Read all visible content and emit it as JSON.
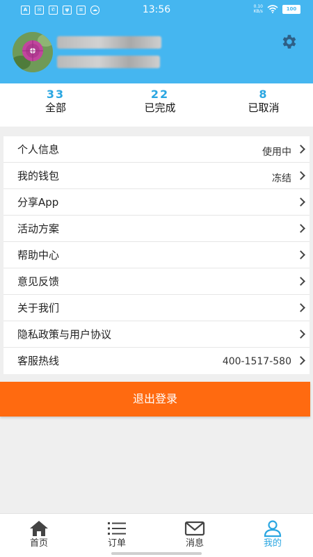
{
  "status_bar": {
    "time": "13:56",
    "network_speed": "0.10\nKB/s",
    "battery": "100"
  },
  "stats": [
    {
      "count": "33",
      "label": "全部"
    },
    {
      "count": "22",
      "label": "已完成"
    },
    {
      "count": "8",
      "label": "已取消"
    }
  ],
  "menu": [
    {
      "label": "个人信息",
      "value": "使用中"
    },
    {
      "label": "我的钱包",
      "value": "冻结"
    },
    {
      "label": "分享App",
      "value": ""
    },
    {
      "label": "活动方案",
      "value": ""
    },
    {
      "label": "帮助中心",
      "value": ""
    },
    {
      "label": "意见反馈",
      "value": ""
    },
    {
      "label": "关于我们",
      "value": ""
    },
    {
      "label": "隐私政策与用户协议",
      "value": ""
    },
    {
      "label": "客服热线",
      "value": "400-1517-580"
    }
  ],
  "logout_label": "退出登录",
  "bottom_nav": [
    {
      "label": "首页",
      "icon": "home-icon"
    },
    {
      "label": "订单",
      "icon": "list-icon"
    },
    {
      "label": "消息",
      "icon": "mail-icon"
    },
    {
      "label": "我的",
      "icon": "person-icon",
      "active": true
    }
  ],
  "colors": {
    "header": "#45b6f0",
    "accent": "#2aa6e1",
    "logout": "#ff6a10"
  }
}
